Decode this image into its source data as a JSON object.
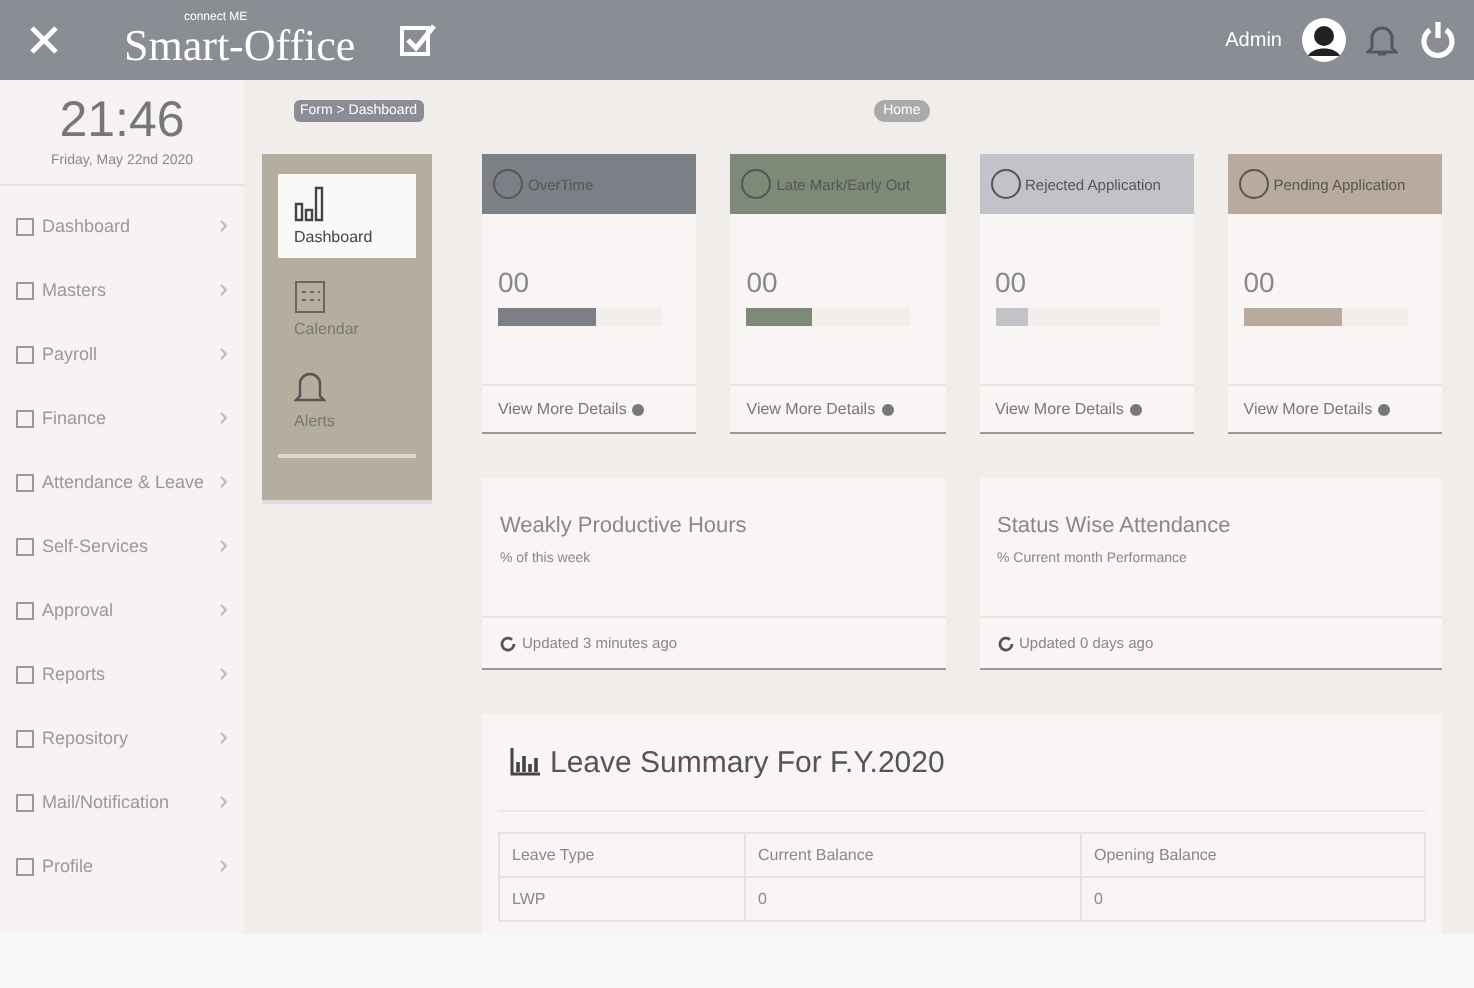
{
  "header": {
    "logo_small": "connect ME",
    "logo": "Smart-Office",
    "user": "Admin"
  },
  "sidebar": {
    "time": "21:46",
    "date": "Friday, May 22nd 2020",
    "items": [
      {
        "label": "Dashboard"
      },
      {
        "label": "Masters"
      },
      {
        "label": "Payroll"
      },
      {
        "label": "Finance"
      },
      {
        "label": "Attendance & Leave"
      },
      {
        "label": "Self-Services"
      },
      {
        "label": "Approval"
      },
      {
        "label": "Reports"
      },
      {
        "label": "Repository"
      },
      {
        "label": "Mail/Notification"
      },
      {
        "label": "Profile"
      }
    ]
  },
  "breadcrumb": "Form > Dashboard",
  "home": "Home",
  "quick_menu": [
    {
      "label": "Dashboard",
      "selected": true
    },
    {
      "label": "Calendar",
      "selected": false
    },
    {
      "label": "Alerts",
      "selected": false
    }
  ],
  "cards": [
    {
      "title": "OverTime",
      "value": "00",
      "level": 0.6,
      "color": "#7d7f86",
      "link": "View More Details"
    },
    {
      "title": "Late Mark/Early Out",
      "value": "00",
      "level": 0.4,
      "color": "#7d8a77",
      "link": "View More Details"
    },
    {
      "title": "Rejected Application",
      "value": "00",
      "level": 0.2,
      "color": "#c2c3c8",
      "link": "View More Details"
    },
    {
      "title": "Pending Application",
      "value": "00",
      "level": 0.6,
      "color": "#b8aa9c",
      "link": "View More Details"
    }
  ],
  "panels": [
    {
      "title": "Weakly Productive Hours",
      "subtitle": "% of this week",
      "updated": "Updated 3 minutes ago"
    },
    {
      "title": "Status Wise Attendance",
      "subtitle": "% Current month Performance",
      "updated": "Updated 0 days ago"
    }
  ],
  "leave_summary": {
    "title": "Leave Summary For F.Y.2020",
    "columns": [
      "Leave Type",
      "Current Balance",
      "Opening Balance"
    ],
    "rows": [
      [
        "LWP",
        "0",
        "0"
      ]
    ]
  }
}
